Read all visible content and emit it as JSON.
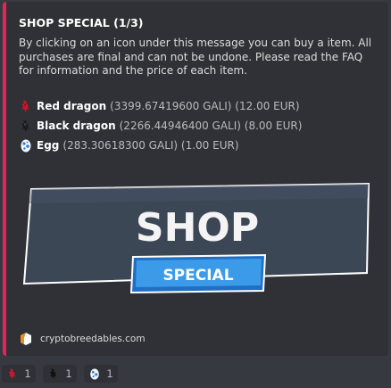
{
  "embed": {
    "accent_color": "#e6245a",
    "title": "SHOP SPECIAL (1/3)",
    "description": "By clicking on an icon under this message you can buy a item. All purchases are final and can not be undone. Please read the FAQ for information and the price of each item.",
    "items": [
      {
        "icon": "red-dragon-icon",
        "name": "Red dragon",
        "price": "(3399.67419600 GALI) (12.00 EUR)"
      },
      {
        "icon": "black-dragon-icon",
        "name": "Black dragon",
        "price": "(2266.44946400 GALI) (8.00 EUR)"
      },
      {
        "icon": "egg-icon",
        "name": "Egg",
        "price": "(283.30618300 GALI) (1.00 EUR)"
      }
    ],
    "image": {
      "line1": "SHOP",
      "line2": "SPECIAL"
    },
    "footer": {
      "icon": "cryptobreedables-logo-icon",
      "text": "cryptobreedables.com"
    }
  },
  "reactions": [
    {
      "icon": "red-dragon-icon",
      "count": "1"
    },
    {
      "icon": "black-dragon-icon",
      "count": "1"
    },
    {
      "icon": "egg-icon",
      "count": "1"
    }
  ]
}
